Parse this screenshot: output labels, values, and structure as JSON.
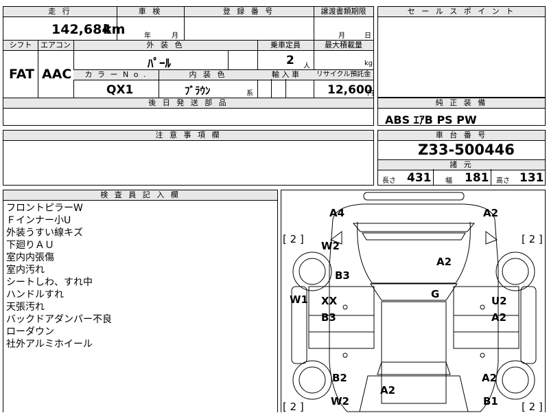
{
  "mileage": {
    "label": "走 行",
    "value": "142,684",
    "unit": "km"
  },
  "inspection": {
    "label": "車 検",
    "year_unit": "年",
    "month_unit": "月"
  },
  "registration": {
    "label": "登 録 番 号"
  },
  "transfer": {
    "label": "譲渡書類期限",
    "month_unit": "月",
    "day_unit": "日"
  },
  "sales_point": {
    "label": "セ ー ル ス ポ イ ン ト"
  },
  "shift": {
    "label": "シフト",
    "value": "FAT"
  },
  "aircon": {
    "label": "エアコン",
    "value": "AAC"
  },
  "exterior_color": {
    "label": "外 装 色",
    "value": "ﾊﾟｰﾙ"
  },
  "capacity": {
    "label": "乗車定員",
    "value": "2",
    "unit": "人"
  },
  "max_load": {
    "label": "最大積載量",
    "unit": "kg"
  },
  "color_no": {
    "label": "カ ラ ー N o .",
    "value": "QX1"
  },
  "interior_color": {
    "label": "内 装 色",
    "value": "ﾌﾞﾗｳﾝ",
    "suffix": "系"
  },
  "import": {
    "label": "輸 入 車"
  },
  "recycle": {
    "label": "リサイクル預託金",
    "value": "12,600",
    "unit": "円"
  },
  "later_parts": {
    "label": "後 日 発 送 部 品"
  },
  "equipment": {
    "label": "純 正 装 備",
    "value": "ABS ｴｱB PS PW"
  },
  "notes": {
    "label": "注 意 事 項 欄"
  },
  "chassis": {
    "label": "車 台 番 号",
    "value": "Z33-500446"
  },
  "specs": {
    "label": "諸 元",
    "length_label": "長さ",
    "length": "431",
    "width_label": "幅",
    "width": "181",
    "height_label": "高さ",
    "height": "131"
  },
  "inspector": {
    "label": "検 査 員 記 入 欄",
    "items": [
      "フロントピラーW",
      "Ｆインナー小U",
      "外装うすい線キズ",
      "下廻りＡＵ",
      "室内内張傷",
      "室内汚れ",
      "シートしわ、すれ中",
      "ハンドルすれ",
      "天張汚れ",
      "バックドアダンパー不良",
      "ローダウン",
      "社外アルミホイール"
    ]
  },
  "diagram": {
    "tire_marks": {
      "fl": "[ 2 ]",
      "fr": "[ 2 ]",
      "rl": "[ 2 ]",
      "rr": "[ 2 ]"
    },
    "marks": {
      "a4": "A4",
      "a2_tr": "A2",
      "w2_top": "W2",
      "a2_hood": "A2",
      "b3_left": "B3",
      "w1": "W1",
      "xx": "XX",
      "g": "G",
      "u2": "U2",
      "b3_mid": "B3",
      "a2_right": "A2",
      "b2": "B2",
      "a2_rr": "A2",
      "a2_rear": "A2",
      "w2_bot": "W2",
      "b1": "B1"
    }
  }
}
